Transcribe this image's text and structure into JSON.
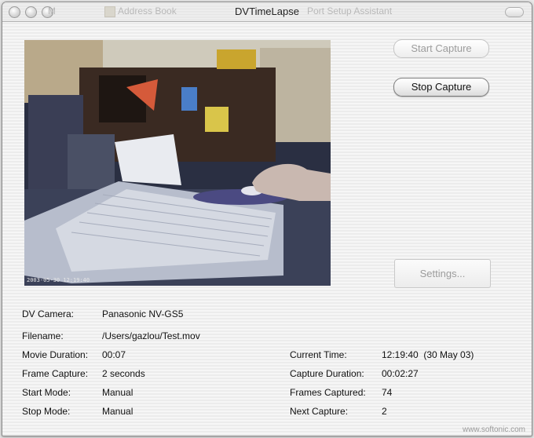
{
  "window": {
    "title": "DVTimeLapse",
    "background_menu_fragments": [
      "M",
      "Address Book",
      "Port Setup Assistant"
    ]
  },
  "preview": {
    "timestamp": "2003-05-30 12:19:40"
  },
  "buttons": {
    "start_capture": "Start Capture",
    "stop_capture": "Stop Capture",
    "settings": "Settings..."
  },
  "info": {
    "dv_camera_label": "DV Camera:",
    "dv_camera_value": "Panasonic NV-GS5",
    "filename_label": "Filename:",
    "filename_value": "/Users/gazlou/Test.mov",
    "movie_duration_label": "Movie Duration:",
    "movie_duration_value": "00:07",
    "frame_capture_label": "Frame Capture:",
    "frame_capture_value": "2 seconds",
    "start_mode_label": "Start Mode:",
    "start_mode_value": "Manual",
    "stop_mode_label": "Stop Mode:",
    "stop_mode_value": "Manual",
    "current_time_label": "Current Time:",
    "current_time_value": "12:19:40  (30 May 03)",
    "capture_duration_label": "Capture Duration:",
    "capture_duration_value": "00:02:27",
    "frames_captured_label": "Frames Captured:",
    "frames_captured_value": "74",
    "next_capture_label": "Next Capture:",
    "next_capture_value": "2"
  },
  "watermark": "www.softonic.com"
}
